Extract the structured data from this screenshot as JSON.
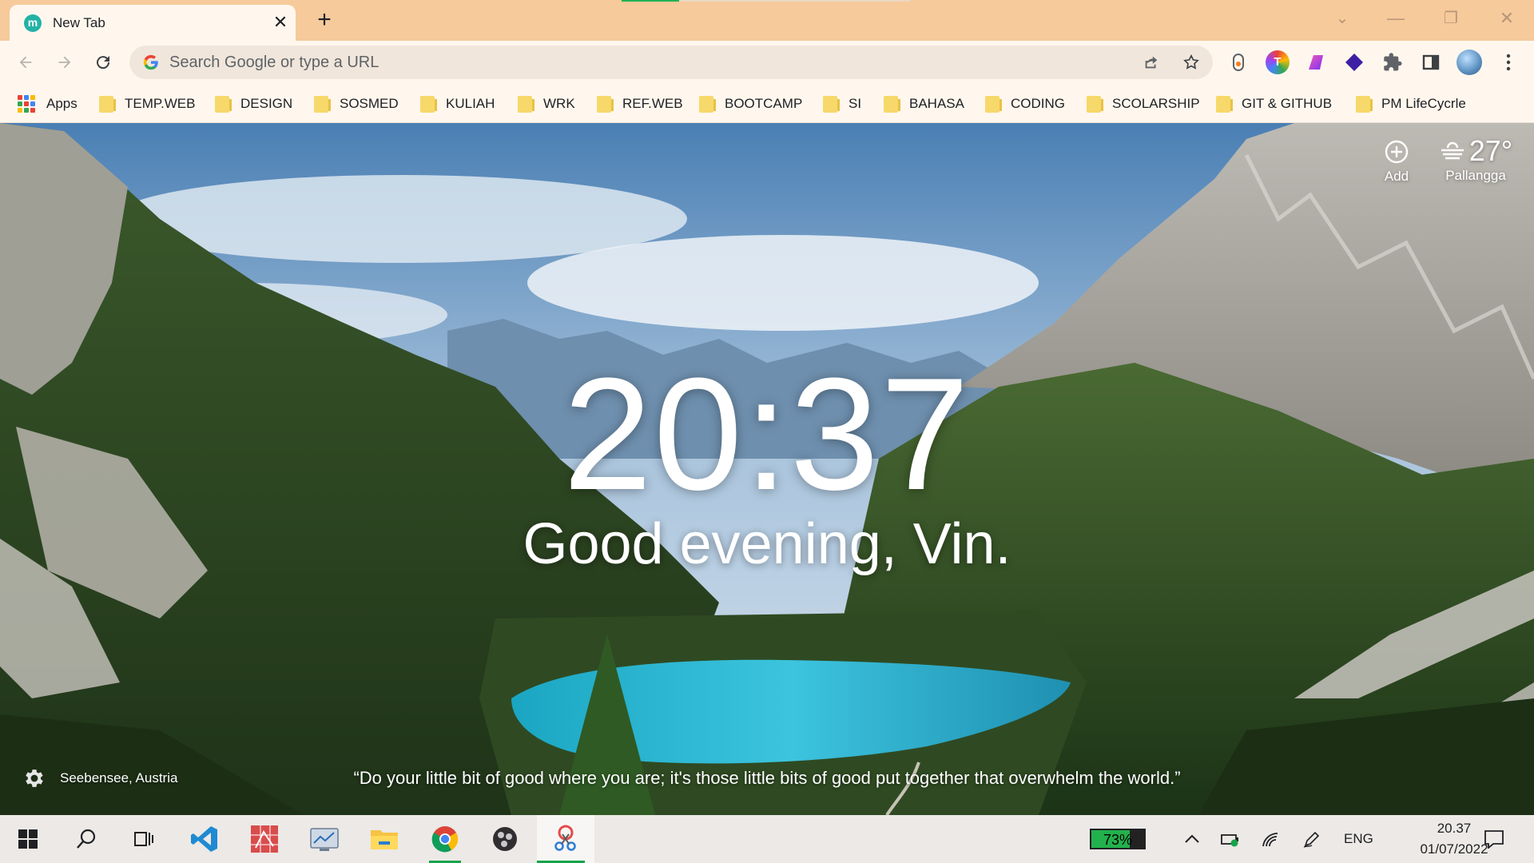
{
  "browser": {
    "tab": {
      "favicon_letter": "m",
      "title": "New Tab",
      "close": "✕"
    },
    "new_tab": "+",
    "window_controls": {
      "dropdown": "⌄",
      "minimize": "—",
      "restore": "❐",
      "close": "✕"
    },
    "page_load_progress": 0.2
  },
  "toolbar": {
    "omnibox_placeholder": "Search Google or type a URL",
    "extension_t_letter": "T"
  },
  "bookmarks": {
    "apps_label": "Apps",
    "folders": [
      "TEMP.WEB",
      "DESIGN",
      "SOSMED",
      "KULIAH",
      "WRK",
      "REF.WEB",
      "BOOTCAMP",
      "SI",
      "BAHASA",
      "CODING",
      "SCOLARSHIP",
      "GIT & GITHUB",
      "PM LifeCycrle"
    ]
  },
  "dashboard": {
    "time": "20:37",
    "greeting": "Good evening, Vin.",
    "add_label": "Add",
    "weather": {
      "temperature": "27°",
      "location": "Pallangga",
      "icon": "haze-icon"
    },
    "quote": "“Do your little bit of good where you are; it's those little bits of good put together that overwhelm the world.”",
    "photo_location": "Seebensee, Austria"
  },
  "taskbar": {
    "battery_percent": "73%",
    "battery_level": 0.73,
    "language": "ENG",
    "clock_time": "20.37",
    "clock_date": "01/07/2022"
  },
  "colors": {
    "tabstrip": "#f6ca9a",
    "toolbar": "#fff7ee",
    "folder": "#f7d86a",
    "taskbar": "#ece9e6",
    "active_indicator": "#16a34a"
  }
}
